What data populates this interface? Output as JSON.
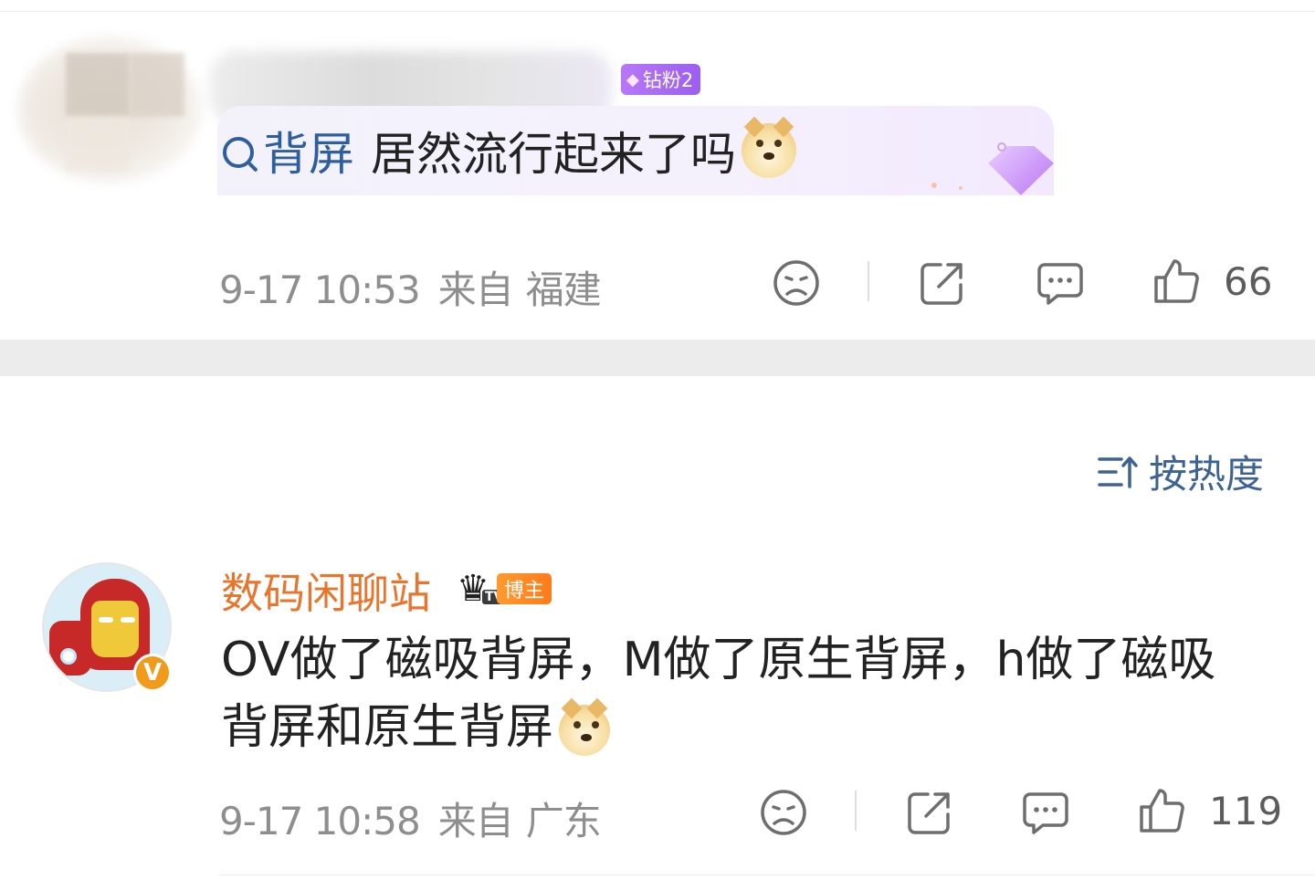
{
  "post1": {
    "badge": "钻粉2",
    "topic": "背屏",
    "text": "居然流行起来了吗",
    "time": "9-17 10:53",
    "source_prefix": "来自",
    "location": "福建",
    "likes": "66"
  },
  "sort": {
    "label": "按热度"
  },
  "post2": {
    "username": "数码闲聊站",
    "role_badge": "博主",
    "tv_tag": "TV",
    "verified_mark": "V",
    "text": "OV做了磁吸背屏，M做了原生背屏，h做了磁吸背屏和原生背屏",
    "time": "9-17 10:58",
    "source_prefix": "来自",
    "location": "广东",
    "likes": "119"
  },
  "icons": {
    "dislike": "sad-face-icon",
    "share": "share-icon",
    "comment": "comment-icon",
    "like": "thumbs-up-icon",
    "search": "search-icon",
    "sort": "sort-icon",
    "emoji": "doge-emoji-icon"
  },
  "colors": {
    "link": "#2e5f9c",
    "username": "#e8752c",
    "meta": "#8e8e8e",
    "fan_badge": "#a765f4",
    "blogger_badge": "#ff8a24"
  }
}
